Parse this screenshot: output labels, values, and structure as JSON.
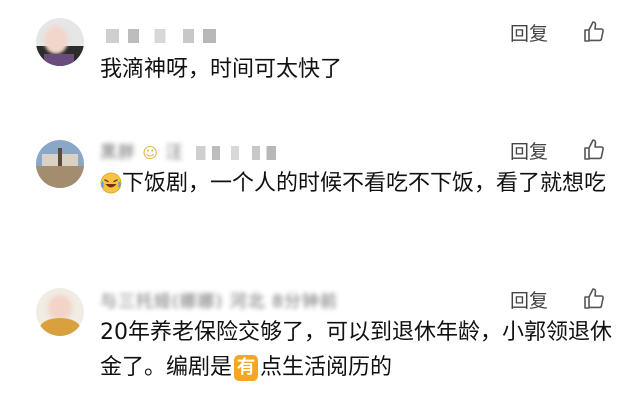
{
  "comments": [
    {
      "username": "",
      "reply_label": "回复",
      "text": "我滴神呀，时间可太快了"
    },
    {
      "username": "黑胖",
      "username_tail": "汪",
      "reply_label": "回复",
      "emoji": "crying-laughing-emoji",
      "text": "下饭剧，一个人的时候不看吃不下饭，看了就想吃"
    },
    {
      "username": "与三托娅(娜娜) 河北 8分钟前",
      "reply_label": "回复",
      "text_before": "20年养老保险交够了，可以到退休年龄，小郭领退休金了。编剧是",
      "badge": "有",
      "text_after": "点生活阅历的"
    }
  ],
  "colors": {
    "badge": "#f5a623",
    "meta_text": "#555555",
    "body_text": "#111111"
  }
}
